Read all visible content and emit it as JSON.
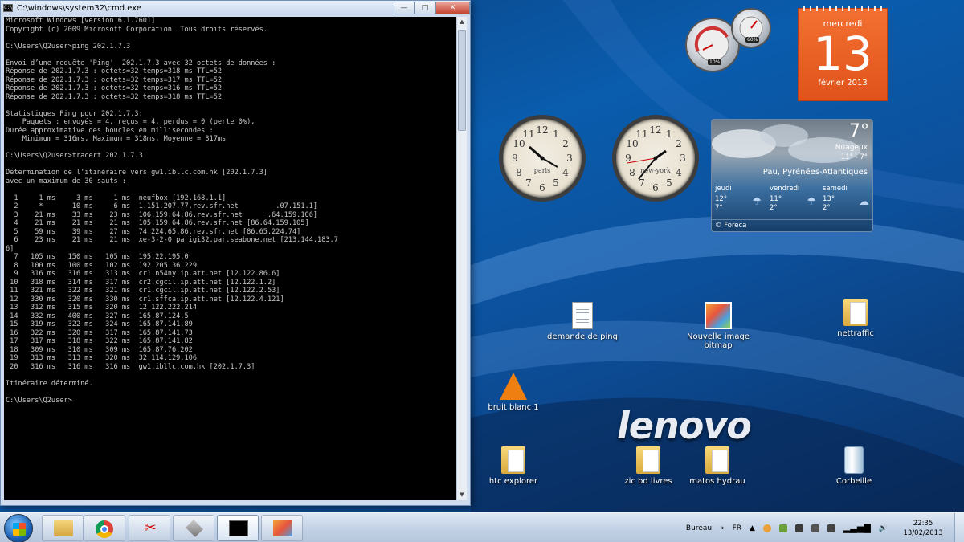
{
  "cmd": {
    "title": "C:\\windows\\system32\\cmd.exe",
    "lines": [
      "Microsoft Windows [version 6.1.7601]",
      "Copyright (c) 2009 Microsoft Corporation. Tous droits réservés.",
      "",
      "C:\\Users\\Q2user>ping 202.1.7.3",
      "",
      "Envoi d’une requête 'Ping'  202.1.7.3 avec 32 octets de données :",
      "Réponse de 202.1.7.3 : octets=32 temps=318 ms TTL=52",
      "Réponse de 202.1.7.3 : octets=32 temps=317 ms TTL=52",
      "Réponse de 202.1.7.3 : octets=32 temps=316 ms TTL=52",
      "Réponse de 202.1.7.3 : octets=32 temps=318 ms TTL=52",
      "",
      "Statistiques Ping pour 202.1.7.3:",
      "    Paquets : envoyés = 4, reçus = 4, perdus = 0 (perte 0%),",
      "Durée approximative des boucles en millisecondes :",
      "    Minimum = 316ms, Maximum = 318ms, Moyenne = 317ms",
      "",
      "C:\\Users\\Q2user>tracert 202.1.7.3",
      "",
      "Détermination de l’itinéraire vers gw1.ibllc.com.hk [202.1.7.3]",
      "avec un maximum de 30 sauts :",
      "",
      "  1     1 ms     3 ms     1 ms  neufbox [192.168.1.1]",
      "  2     *       10 ms     6 ms  1.151.207.77.rev.sfr.net         .07.151.1]",
      "  3    21 ms    33 ms    23 ms  106.159.64.86.rev.sfr.net      .64.159.106]",
      "  4    21 ms    21 ms    21 ms  105.159.64.86.rev.sfr.net [86.64.159.105]",
      "  5    59 ms    39 ms    27 ms  74.224.65.86.rev.sfr.net [86.65.224.74]",
      "  6    23 ms    21 ms    21 ms  xe-3-2-0.parigi32.par.seabone.net [213.144.183.7",
      "6]",
      "  7   105 ms   150 ms   105 ms  195.22.195.0",
      "  8   100 ms   100 ms   102 ms  192.205.36.229",
      "  9   316 ms   316 ms   313 ms  cr1.n54ny.ip.att.net [12.122.86.6]",
      " 10   318 ms   314 ms   317 ms  cr2.cgcil.ip.att.net [12.122.1.2]",
      " 11   321 ms   322 ms   321 ms  cr1.cgcil.ip.att.net [12.122.2.53]",
      " 12   330 ms   320 ms   330 ms  cr1.sffca.ip.att.net [12.122.4.121]",
      " 13   312 ms   315 ms   320 ms  12.122.222.214",
      " 14   332 ms   400 ms   327 ms  165.87.124.5",
      " 15   319 ms   322 ms   324 ms  165.87.141.89",
      " 16   322 ms   320 ms   317 ms  165.87.141.73",
      " 17   317 ms   318 ms   322 ms  165.87.141.82",
      " 18   309 ms   310 ms   309 ms  165.87.76.202",
      " 19   313 ms   313 ms   320 ms  32.114.129.106",
      " 20   316 ms   316 ms   316 ms  gw1.ibllc.com.hk [202.1.7.3]",
      "",
      "Itinéraire déterminé.",
      "",
      "C:\\Users\\Q2user>"
    ],
    "scroll_position": 0.0
  },
  "meters": {
    "cpu_label": "10%",
    "mem_label": "60%"
  },
  "calendar": {
    "weekday": "mercredi",
    "day": "13",
    "month_year": "février 2013"
  },
  "clocks": [
    {
      "label": "paris"
    },
    {
      "label": "new-york"
    }
  ],
  "weather": {
    "temperature": "7°",
    "condition": "Nuageux",
    "range": "11° - 7°",
    "location": "Pau, Pyrénées-Atlantiques",
    "forecast": [
      {
        "day": "jeudi",
        "high": "12°",
        "low": "7°"
      },
      {
        "day": "vendredi",
        "high": "11°",
        "low": "2°"
      },
      {
        "day": "samedi",
        "high": "13°",
        "low": "2°"
      }
    ],
    "provider": "© Foreca"
  },
  "desktop_icons": [
    {
      "label": "demande de ping"
    },
    {
      "label": "Nouvelle image bitmap"
    },
    {
      "label": "nettraffic"
    },
    {
      "label": "bruit blanc 1"
    },
    {
      "label": "htc explorer"
    },
    {
      "label": "zic bd livres"
    },
    {
      "label": "matos hydrau"
    },
    {
      "label": "Corbeille"
    }
  ],
  "brand": "lenovo",
  "taskbar": {
    "tray_label": "Bureau",
    "lang": "FR",
    "time": "22:35",
    "date": "13/02/2013"
  }
}
